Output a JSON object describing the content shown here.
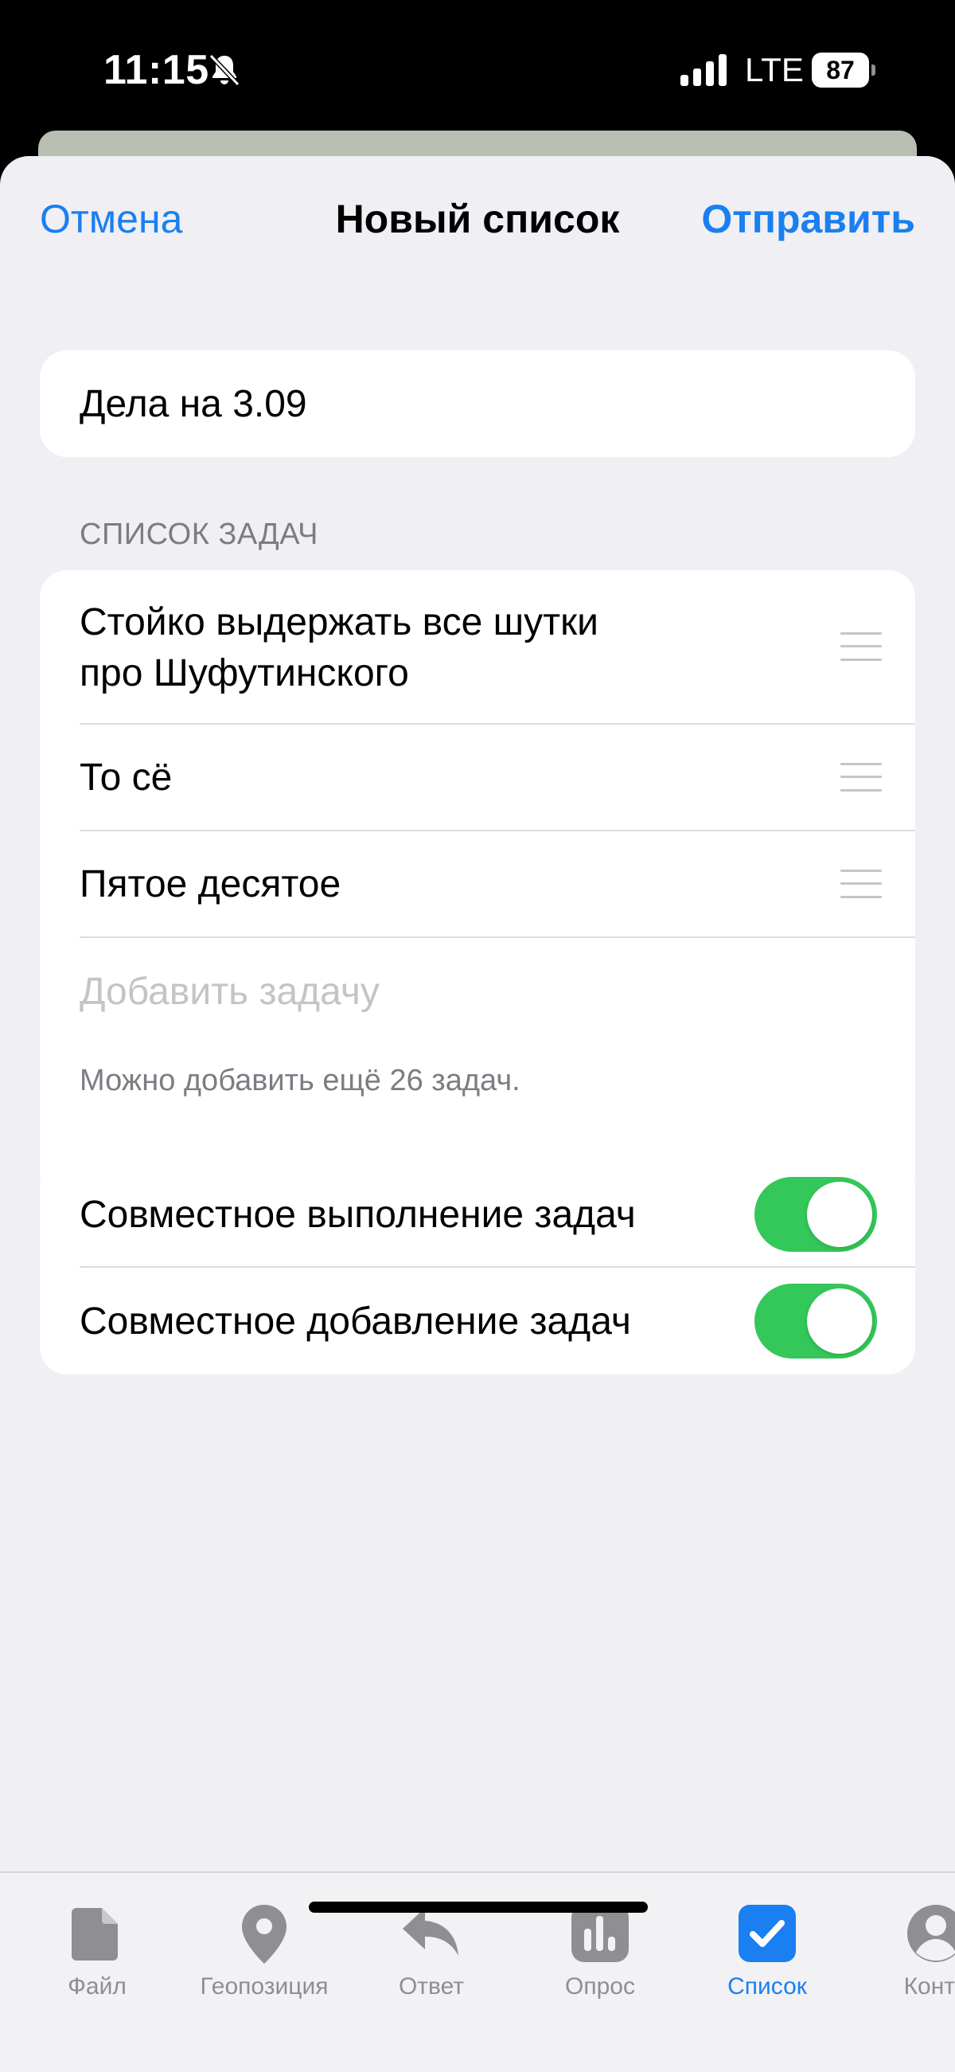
{
  "status_bar": {
    "time": "11:15",
    "network": "LTE",
    "battery": "87"
  },
  "nav": {
    "cancel": "Отмена",
    "title": "Новый список",
    "send": "Отправить"
  },
  "list_title": "Дела на 3.09",
  "tasks_section": {
    "header": "СПИСОК ЗАДАЧ",
    "items": [
      {
        "line1": "Стойко выдержать все шутки",
        "line2": "про Шуфутинского"
      },
      {
        "line1": "То сё"
      },
      {
        "line1": "Пятое десятое"
      }
    ],
    "add_placeholder": "Добавить задачу",
    "footer": "Можно добавить ещё 26 задач."
  },
  "options": [
    {
      "label": "Совместное выполнение задач",
      "on": true
    },
    {
      "label": "Совместное добавление задач",
      "on": true
    }
  ],
  "tabbar": [
    {
      "label": "Файл",
      "icon": "file-icon"
    },
    {
      "label": "Геопозиция",
      "icon": "location-pin-icon"
    },
    {
      "label": "Ответ",
      "icon": "reply-arrow-icon"
    },
    {
      "label": "Опрос",
      "icon": "poll-chart-icon"
    },
    {
      "label": "Список",
      "icon": "checklist-checkbox-icon",
      "active": true
    },
    {
      "label": "Конта",
      "icon": "contact-person-icon"
    }
  ],
  "colors": {
    "accent": "#1a7ff0",
    "toggle_on": "#34c759",
    "background": "#efeff4"
  }
}
